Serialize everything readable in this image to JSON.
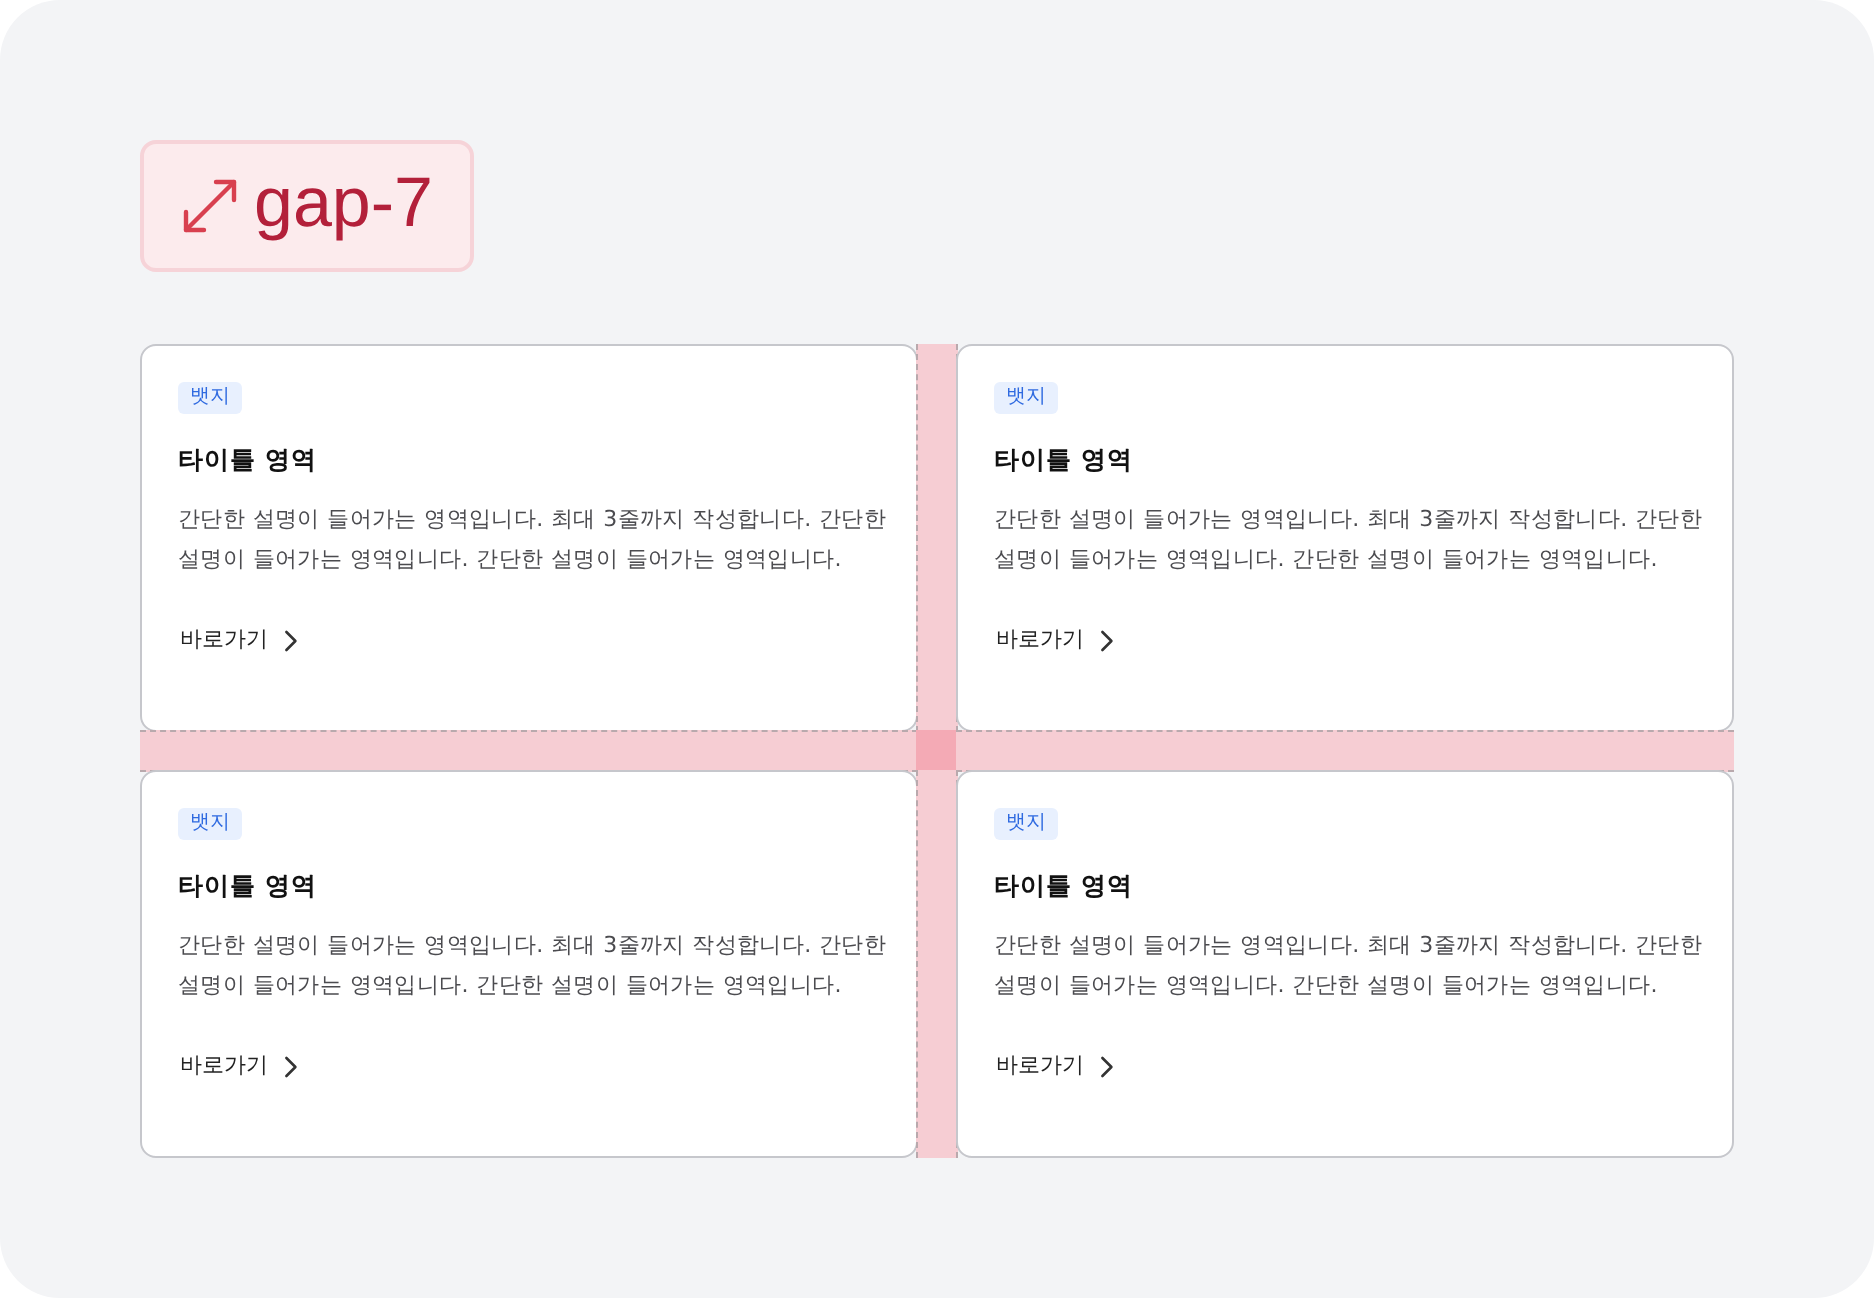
{
  "label": {
    "text": "gap-7"
  },
  "cards": [
    {
      "badge": "뱃지",
      "title": "타이틀 영역",
      "description": "간단한 설명이 들어가는 영역입니다. 최대 3줄까지 작성합니다. 간단한 설명이 들어가는 영역입니다. 간단한 설명이 들어가는 영역입니다.",
      "link": "바로가기"
    },
    {
      "badge": "뱃지",
      "title": "타이틀 영역",
      "description": "간단한 설명이 들어가는 영역입니다. 최대 3줄까지 작성합니다. 간단한 설명이 들어가는 영역입니다. 간단한 설명이 들어가는 영역입니다.",
      "link": "바로가기"
    },
    {
      "badge": "뱃지",
      "title": "타이틀 영역",
      "description": "간단한 설명이 들어가는 영역입니다. 최대 3줄까지 작성합니다. 간단한 설명이 들어가는 영역입니다. 간단한 설명이 들어가는 영역입니다.",
      "link": "바로가기"
    },
    {
      "badge": "뱃지",
      "title": "타이틀 영역",
      "description": "간단한 설명이 들어가는 영역입니다. 최대 3줄까지 작성합니다. 간단한 설명이 들어가는 영역입니다. 간단한 설명이 들어가는 영역입니다.",
      "link": "바로가기"
    }
  ]
}
